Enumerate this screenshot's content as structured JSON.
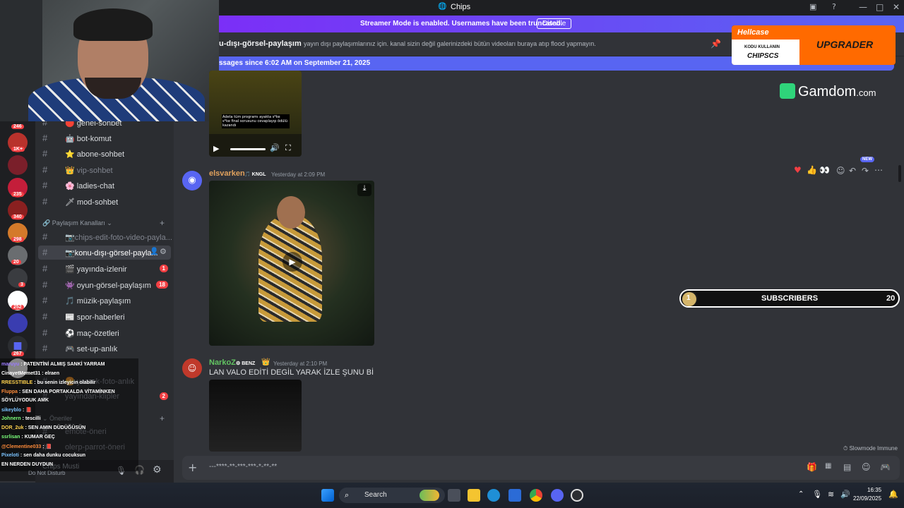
{
  "window": {
    "title": "Chips",
    "minimize": "—",
    "maximize": "□",
    "close": "✕"
  },
  "banner": {
    "text": "Streamer Mode is enabled. Usernames have been truncated.",
    "button": "Disable"
  },
  "channel_header": {
    "name": "u-dışı-görsel-paylaşım",
    "topic": "yayın dışı paylaşımlarınız için. kanal sizin değil galerinizdeki bütün videoları buraya atıp flood yapmayın."
  },
  "new_messages_bar": "ssages since 6:02 AM on September 21, 2025",
  "server_badges": [
    "246",
    "1K+",
    "",
    "235",
    "340",
    "298",
    "20",
    "3",
    "252",
    "",
    "267"
  ],
  "channels": [
    {
      "name": "genel-sohbet",
      "emoji": "🔴",
      "muted": false
    },
    {
      "name": "bot-komut",
      "emoji": "🤖",
      "muted": false
    },
    {
      "name": "abone-sohbet",
      "emoji": "⭐",
      "muted": false
    },
    {
      "name": "vip-sohbet",
      "emoji": "👑",
      "muted": true
    },
    {
      "name": "ladies-chat",
      "emoji": "🌸",
      "muted": false
    },
    {
      "name": "mod-sohbet",
      "emoji": "🗡",
      "muted": false
    }
  ],
  "category_paylasim": "Paylaşım Kanalları",
  "channels2": [
    {
      "name": "chips-edit-foto-video-payla...",
      "emoji": "📷",
      "muted": true,
      "badge": ""
    },
    {
      "name": "konu-dışı-görsel-payla...",
      "emoji": "📷",
      "muted": false,
      "badge": "",
      "active": true
    },
    {
      "name": "yayında-izlenir",
      "emoji": "🎬",
      "muted": false,
      "badge": "1"
    },
    {
      "name": "oyun-görsel-paylaşım",
      "emoji": "👾",
      "muted": false,
      "badge": "18"
    },
    {
      "name": "müzik-paylaşım",
      "emoji": "🎵",
      "muted": false,
      "badge": ""
    },
    {
      "name": "spor-haberleri",
      "emoji": "📰",
      "muted": false,
      "badge": ""
    },
    {
      "name": "maç-özetleri",
      "emoji": "⚽",
      "muted": false,
      "badge": ""
    },
    {
      "name": "set-up-anlık",
      "emoji": "🎮",
      "muted": false,
      "badge": ""
    },
    {
      "name": "yemek-foto-anlık",
      "emoji": "🍔",
      "muted": true,
      "badge": ""
    },
    {
      "name": "yayından-klipler",
      "emoji": "",
      "muted": true,
      "badge": "2"
    }
  ],
  "category_oneriler": "Öneriler",
  "channels3": [
    {
      "name": "emote-öneri",
      "emoji": "",
      "muted": true
    },
    {
      "name": "olerp-parrot-öneri",
      "emoji": "",
      "muted": true
    }
  ],
  "user": {
    "name": "Chips Musti",
    "status": "Do Not Disturb"
  },
  "chat_overlay": [
    {
      "user": "maruyu",
      "text": ": PATENTİNİ ALMIŞ SANKİ YARRAM",
      "color": "#9b7bff"
    },
    {
      "user": "CinayetMemet31",
      "text": ": elraen",
      "color": "#ffffff"
    },
    {
      "user": "RRESSTIBLE",
      "text": ": bu senin izleyicin olabilir",
      "color": "#ffd24d"
    },
    {
      "user": "Fluppa",
      "text": ": SEN DAHA PORTAKALDA VİTAMİNKEN",
      "color": "#ff8c3a"
    },
    {
      "user": "",
      "text": "SÖYLÜYODUK AMK",
      "color": "#ffffff"
    },
    {
      "user": "sikeyblo",
      "text": ": 📕",
      "color": "#7bc4ff"
    },
    {
      "user": "Johnern",
      "text": ": tescilli",
      "color": "#7bff7b"
    },
    {
      "user": "DOR_2uk",
      "text": ": SEN AMIN DÜDÜĞÜSÜN",
      "color": "#ffd24d"
    },
    {
      "user": "ssrlisan",
      "text": ": KUMAR GEÇ",
      "color": "#7bff7b"
    },
    {
      "user": "@Clementine033",
      "text": ": 📕",
      "color": "#ff8c3a"
    },
    {
      "user": "Pixeloti",
      "text": ": sen daha dunku cocuksun",
      "color": "#7bc4ff"
    },
    {
      "user": "",
      "text": "EN NERDEN DUYDUN",
      "color": "#ffffff"
    }
  ],
  "messages": {
    "video_caption": "Adeta tüm programı ayakta s*ke s*ke final sorusunu cevaplayıp ödülü kazandı",
    "m1": {
      "author": "elsvarken",
      "author_color": "#e0a15d",
      "tag": "KNGL",
      "time": "Yesterday at 2:09 PM"
    },
    "m2": {
      "author": "NarkoZ",
      "author_color": "#62c462",
      "tag": "BENZ",
      "time": "Yesterday at 2:10 PM",
      "text": "LAN VALO EDİTİ DEGİL YARAK İZLE ŞUNU Bİ"
    },
    "new_badge": "NEW"
  },
  "composer": {
    "placeholder": "---****-**-***-***-*-**-**"
  },
  "slowmode": "Slowmode Immune",
  "overlays": {
    "hellcase": "Hellcase",
    "promo_line1": "KODU KULLANIN",
    "promo_line2": "CHIPSCS",
    "upgrader": "UPGRADER",
    "gamdom": "Gamdom",
    "gamdom_suffix": ".com",
    "subs_label": "SUBSCRIBERS",
    "subs_current": "1",
    "subs_goal": "20"
  },
  "taskbar": {
    "search": "Search",
    "time": "16:35",
    "date": "22/09/2025"
  },
  "colors": {
    "accent": "#5865f2",
    "bg": "#313338",
    "sidebar": "#2b2d31"
  }
}
